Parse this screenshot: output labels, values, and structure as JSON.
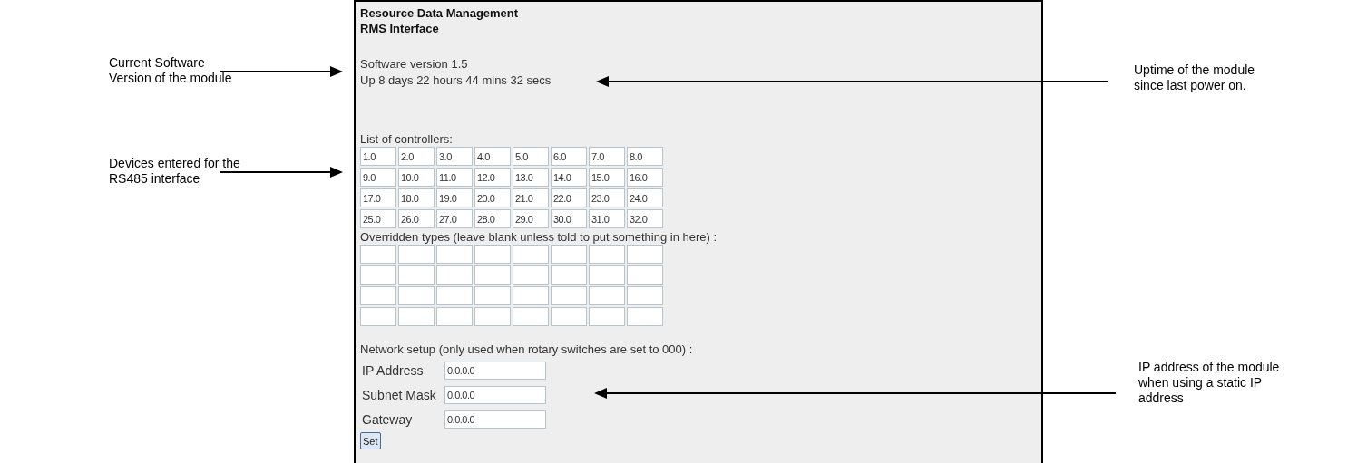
{
  "panel": {
    "title": [
      "Resource Data Management",
      "RMS Interface"
    ],
    "version": "Software version 1.5",
    "uptime": "Up 8 days 22 hours 44 mins 32 secs",
    "controllers": {
      "label": "List of controllers:",
      "rows": [
        [
          "1.0",
          "2.0",
          "3.0",
          "4.0",
          "5.0",
          "6.0",
          "7.0",
          "8.0"
        ],
        [
          "9.0",
          "10.0",
          "11.0",
          "12.0",
          "13.0",
          "14.0",
          "15.0",
          "16.0"
        ],
        [
          "17.0",
          "18.0",
          "19.0",
          "20.0",
          "21.0",
          "22.0",
          "23.0",
          "24.0"
        ],
        [
          "25.0",
          "26.0",
          "27.0",
          "28.0",
          "29.0",
          "30.0",
          "31.0",
          "32.0"
        ]
      ]
    },
    "overridden": {
      "label": "Overridden types (leave blank unless told to put something in here) :"
    },
    "network": {
      "label": "Network setup (only used when rotary switches are set to 000) :",
      "fields": [
        {
          "label": "IP Address",
          "value": "0.0.0.0"
        },
        {
          "label": "Subnet Mask",
          "value": "0.0.0.0"
        },
        {
          "label": "Gateway",
          "value": "0.0.0.0"
        }
      ],
      "button": "Set"
    }
  },
  "annotations": [
    {
      "kind": "left",
      "text": "Current Software\nVersion of the module"
    },
    {
      "kind": "left",
      "text": "Devices entered for the\nRS485 interface"
    },
    {
      "kind": "right",
      "text": "Uptime of the module\nsince last power on."
    },
    {
      "kind": "right",
      "text": "IP address of the module\nwhen using a static IP\naddress"
    }
  ]
}
